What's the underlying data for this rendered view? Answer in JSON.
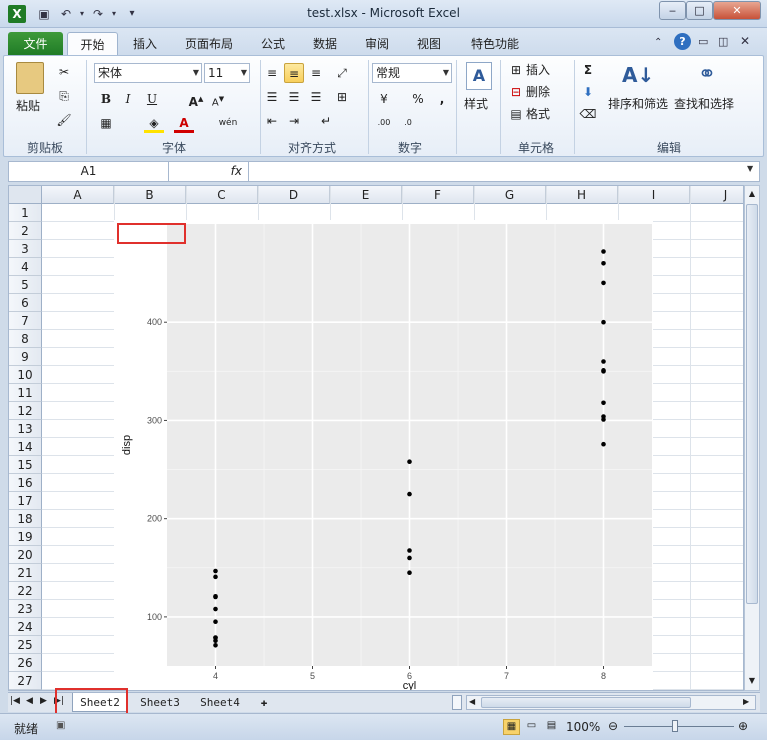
{
  "window": {
    "title": "test.xlsx  -  Microsoft Excel"
  },
  "ribbon": {
    "tabs": [
      "文件",
      "开始",
      "插入",
      "页面布局",
      "公式",
      "数据",
      "审阅",
      "视图",
      "特色功能"
    ],
    "clipboard": {
      "paste": "粘贴",
      "label": "剪贴板"
    },
    "font": {
      "name": "宋体",
      "size": "11",
      "label": "字体"
    },
    "alignment": {
      "label": "对齐方式"
    },
    "number": {
      "format": "常规",
      "percent": "%",
      "label": "数字"
    },
    "styles": {
      "button": "样式"
    },
    "cells": {
      "insert": "插入",
      "delete": "删除",
      "format": "格式",
      "label": "单元格"
    },
    "editing": {
      "sum": "Σ",
      "sort_filter": "排序和筛选",
      "find_select": "查找和选择",
      "label": "编辑"
    }
  },
  "formula_bar": {
    "name_box": "A1",
    "fx": "fx"
  },
  "grid": {
    "columns": [
      "A",
      "B",
      "C",
      "D",
      "E",
      "F",
      "G",
      "H",
      "I",
      "J"
    ],
    "rows": [
      "1",
      "2",
      "3",
      "4",
      "5",
      "6",
      "7",
      "8",
      "9",
      "10",
      "11",
      "12",
      "13",
      "14",
      "15",
      "16",
      "17",
      "18",
      "19",
      "20",
      "21",
      "22",
      "23",
      "24",
      "25",
      "26",
      "27"
    ]
  },
  "sheets": {
    "tabs": [
      "Sheet2",
      "Sheet3",
      "Sheet4"
    ],
    "active": "Sheet2"
  },
  "status": {
    "ready": "就绪",
    "zoom": "100%"
  },
  "chart_data": {
    "type": "scatter",
    "xlabel": "cyl",
    "ylabel": "disp",
    "xlim": [
      3.5,
      8.5
    ],
    "ylim": [
      50,
      500
    ],
    "x_ticks": [
      4,
      5,
      6,
      7,
      8
    ],
    "y_ticks": [
      100,
      200,
      300,
      400
    ],
    "grid": true,
    "background": "#ebebeb",
    "points": [
      {
        "x": 4,
        "y": 146.7
      },
      {
        "x": 4,
        "y": 140.8
      },
      {
        "x": 4,
        "y": 120.3
      },
      {
        "x": 4,
        "y": 121
      },
      {
        "x": 4,
        "y": 108
      },
      {
        "x": 4,
        "y": 95.1
      },
      {
        "x": 4,
        "y": 79
      },
      {
        "x": 4,
        "y": 78.7
      },
      {
        "x": 4,
        "y": 75.7
      },
      {
        "x": 4,
        "y": 71.1
      },
      {
        "x": 6,
        "y": 258
      },
      {
        "x": 6,
        "y": 225
      },
      {
        "x": 6,
        "y": 167.6
      },
      {
        "x": 6,
        "y": 160
      },
      {
        "x": 6,
        "y": 145
      },
      {
        "x": 8,
        "y": 472
      },
      {
        "x": 8,
        "y": 460
      },
      {
        "x": 8,
        "y": 440
      },
      {
        "x": 8,
        "y": 400
      },
      {
        "x": 8,
        "y": 360
      },
      {
        "x": 8,
        "y": 351
      },
      {
        "x": 8,
        "y": 350
      },
      {
        "x": 8,
        "y": 318
      },
      {
        "x": 8,
        "y": 304
      },
      {
        "x": 8,
        "y": 301
      },
      {
        "x": 8,
        "y": 275.8
      }
    ]
  }
}
